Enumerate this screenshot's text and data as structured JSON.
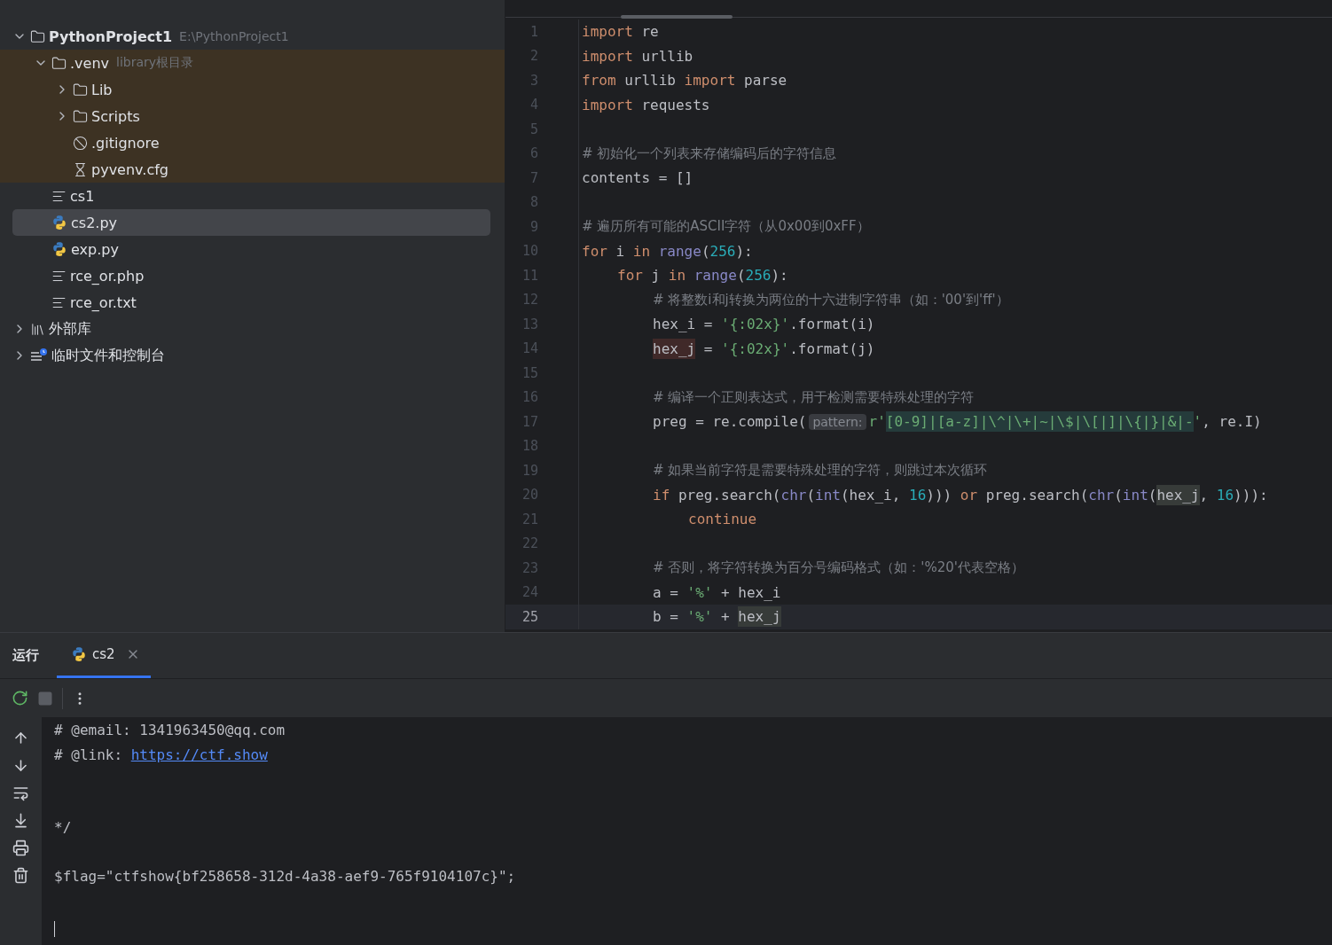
{
  "project_tree": [
    {
      "label": "PythonProject1",
      "hint": "E:\\PythonProject1",
      "kind": "project-folder",
      "expanded": true,
      "selected": false,
      "excluded": false,
      "children": [
        {
          "label": ".venv",
          "hint": "library根目录",
          "kind": "folder",
          "expanded": true,
          "selected": false,
          "excluded": true,
          "children": [
            {
              "label": "Lib",
              "kind": "folder",
              "expanded": false,
              "selected": false,
              "excluded": true
            },
            {
              "label": "Scripts",
              "kind": "folder",
              "expanded": false,
              "selected": false,
              "excluded": true
            },
            {
              "label": ".gitignore",
              "kind": "ignore-file",
              "selected": false,
              "excluded": true
            },
            {
              "label": "pyvenv.cfg",
              "kind": "config-file",
              "selected": false,
              "excluded": true
            }
          ]
        },
        {
          "label": "cs1",
          "kind": "text-file",
          "selected": false,
          "excluded": false
        },
        {
          "label": "cs2.py",
          "kind": "python-file",
          "selected": true,
          "excluded": false
        },
        {
          "label": "exp.py",
          "kind": "python-file",
          "selected": false,
          "excluded": false
        },
        {
          "label": "rce_or.php",
          "kind": "text-file",
          "selected": false,
          "excluded": false
        },
        {
          "label": "rce_or.txt",
          "kind": "text-file",
          "selected": false,
          "excluded": false
        }
      ]
    },
    {
      "label": "外部库",
      "kind": "library",
      "expanded": false,
      "selected": false,
      "excluded": false
    },
    {
      "label": "临时文件和控制台",
      "kind": "scratches",
      "expanded": false,
      "selected": false,
      "excluded": false
    }
  ],
  "editor": {
    "lines": [
      {
        "number": "1",
        "current": false,
        "tokens": [
          {
            "kind": "keyword",
            "text": "import"
          },
          {
            "kind": "plain",
            "text": " re"
          }
        ]
      },
      {
        "number": "2",
        "current": false,
        "tokens": [
          {
            "kind": "keyword",
            "text": "import"
          },
          {
            "kind": "plain",
            "text": " urllib"
          }
        ]
      },
      {
        "number": "3",
        "current": false,
        "tokens": [
          {
            "kind": "keyword",
            "text": "from"
          },
          {
            "kind": "plain",
            "text": " urllib "
          },
          {
            "kind": "keyword",
            "text": "import"
          },
          {
            "kind": "plain",
            "text": " parse"
          }
        ]
      },
      {
        "number": "4",
        "current": false,
        "tokens": [
          {
            "kind": "keyword",
            "text": "import"
          },
          {
            "kind": "plain",
            "text": " requests"
          }
        ]
      },
      {
        "number": "5",
        "current": false
      },
      {
        "number": "6",
        "current": false,
        "tokens": [
          {
            "kind": "comment",
            "text": "# 初始化一个列表来存储编码后的字符信息"
          }
        ]
      },
      {
        "number": "7",
        "current": false,
        "tokens": [
          {
            "kind": "plain",
            "text": "contents = []"
          }
        ]
      },
      {
        "number": "8",
        "current": false
      },
      {
        "number": "9",
        "current": false,
        "tokens": [
          {
            "kind": "comment",
            "text": "# 遍历所有可能的ASCII字符（从0x00到0xFF）"
          }
        ]
      },
      {
        "number": "10",
        "current": false,
        "tokens": [
          {
            "kind": "keyword",
            "text": "for"
          },
          {
            "kind": "plain",
            "text": " i "
          },
          {
            "kind": "keyword",
            "text": "in"
          },
          {
            "kind": "builtin",
            "text": " range"
          },
          {
            "kind": "plain",
            "text": "("
          },
          {
            "kind": "number",
            "text": "256"
          },
          {
            "kind": "plain",
            "text": "):"
          }
        ],
        "children": [
          {
            "number": "11",
            "current": false,
            "tokens": [
              {
                "kind": "keyword",
                "text": "for"
              },
              {
                "kind": "plain",
                "text": " j "
              },
              {
                "kind": "keyword",
                "text": "in"
              },
              {
                "kind": "builtin",
                "text": " range"
              },
              {
                "kind": "plain",
                "text": "("
              },
              {
                "kind": "number",
                "text": "256"
              },
              {
                "kind": "plain",
                "text": "):"
              }
            ],
            "children": [
              {
                "number": "12",
                "current": false,
                "tokens": [
                  {
                    "kind": "comment",
                    "text": "# 将整数i和j转换为两位的十六进制字符串（如：'00'到'ff'）"
                  }
                ]
              },
              {
                "number": "13",
                "current": false,
                "tokens": [
                  {
                    "kind": "plain",
                    "text": "hex_i = "
                  },
                  {
                    "kind": "string",
                    "text": "'{:02x}'"
                  },
                  {
                    "kind": "plain",
                    "text": ".format(i)"
                  }
                ]
              },
              {
                "number": "14",
                "current": false,
                "tokens": [
                  {
                    "kind": "write-usage",
                    "text": "hex_j"
                  },
                  {
                    "kind": "plain",
                    "text": " = "
                  },
                  {
                    "kind": "string",
                    "text": "'{:02x}'"
                  },
                  {
                    "kind": "plain",
                    "text": ".format(j)"
                  }
                ]
              },
              {
                "number": "15",
                "current": false
              },
              {
                "number": "16",
                "current": false,
                "tokens": [
                  {
                    "kind": "comment",
                    "text": "# 编译一个正则表达式，用于检测需要特殊处理的字符"
                  }
                ]
              },
              {
                "number": "17",
                "current": false,
                "tokens": [
                  {
                    "kind": "plain",
                    "text": "preg = re.compile("
                  },
                  {
                    "kind": "hint",
                    "text": "pattern:"
                  },
                  {
                    "kind": "string",
                    "text": "r'"
                  },
                  {
                    "kind": "regex",
                    "text": "[0-9]|[a-z]|\\^|\\+|~|\\$|\\[|]|\\{|}|&|-"
                  },
                  {
                    "kind": "string",
                    "text": "'"
                  },
                  {
                    "kind": "plain",
                    "text": ", re.I)"
                  }
                ]
              },
              {
                "number": "18",
                "current": false
              },
              {
                "number": "19",
                "current": false,
                "tokens": [
                  {
                    "kind": "comment",
                    "text": "# 如果当前字符是需要特殊处理的字符，则跳过本次循环"
                  }
                ]
              },
              {
                "number": "20",
                "current": false,
                "tokens": [
                  {
                    "kind": "keyword",
                    "text": "if"
                  },
                  {
                    "kind": "plain",
                    "text": " preg.search("
                  },
                  {
                    "kind": "builtin",
                    "text": "chr"
                  },
                  {
                    "kind": "plain",
                    "text": "("
                  },
                  {
                    "kind": "builtin",
                    "text": "int"
                  },
                  {
                    "kind": "plain",
                    "text": "(hex_i, "
                  },
                  {
                    "kind": "number",
                    "text": "16"
                  },
                  {
                    "kind": "plain",
                    "text": "))) "
                  },
                  {
                    "kind": "keyword",
                    "text": "or"
                  },
                  {
                    "kind": "plain",
                    "text": " preg.search("
                  },
                  {
                    "kind": "builtin",
                    "text": "chr"
                  },
                  {
                    "kind": "plain",
                    "text": "("
                  },
                  {
                    "kind": "builtin",
                    "text": "int"
                  },
                  {
                    "kind": "plain",
                    "text": "("
                  },
                  {
                    "kind": "usage",
                    "text": "hex_j"
                  },
                  {
                    "kind": "plain",
                    "text": ", "
                  },
                  {
                    "kind": "number",
                    "text": "16"
                  },
                  {
                    "kind": "plain",
                    "text": "))):"
                  }
                ],
                "children": [
                  {
                    "number": "21",
                    "current": false,
                    "tokens": [
                      {
                        "kind": "keyword",
                        "text": "continue"
                      }
                    ]
                  }
                ]
              },
              {
                "number": "22",
                "current": false
              },
              {
                "number": "23",
                "current": false,
                "tokens": [
                  {
                    "kind": "comment",
                    "text": "# 否则，将字符转换为百分号编码格式（如：'%20'代表空格）"
                  }
                ]
              },
              {
                "number": "24",
                "current": false,
                "tokens": [
                  {
                    "kind": "plain",
                    "text": "a = "
                  },
                  {
                    "kind": "string",
                    "text": "'%'"
                  },
                  {
                    "kind": "plain",
                    "text": " + hex_i"
                  }
                ]
              },
              {
                "number": "25",
                "current": true,
                "tokens": [
                  {
                    "kind": "plain",
                    "text": "b = "
                  },
                  {
                    "kind": "string",
                    "text": "'%'"
                  },
                  {
                    "kind": "plain",
                    "text": " + "
                  },
                  {
                    "kind": "usage",
                    "text": "hex_j"
                  }
                ]
              }
            ]
          }
        ]
      }
    ]
  },
  "run_panel": {
    "title": "运行",
    "tabs": [
      {
        "label": "cs2",
        "selected": true
      }
    ],
    "console": [
      {
        "kind": "text",
        "text": "# @email: 1341963450@qq.com"
      },
      {
        "kind": "link",
        "text": "# @link: ",
        "link": "https://ctf.show"
      },
      {
        "kind": "blank"
      },
      {
        "kind": "blank"
      },
      {
        "kind": "text",
        "text": "*/"
      },
      {
        "kind": "blank"
      },
      {
        "kind": "text",
        "text": "$flag=\"ctfshow{bf258658-312d-4a38-aef9-765f9104107c}\";"
      },
      {
        "kind": "blank"
      },
      {
        "kind": "cursor"
      }
    ]
  }
}
